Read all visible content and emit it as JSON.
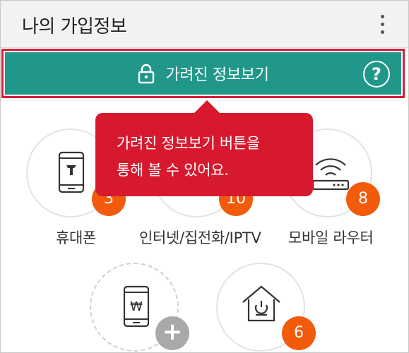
{
  "header": {
    "title": "나의 가입정보",
    "menu_icon": "more-vertical-icon"
  },
  "reveal_bar": {
    "label": "가려진 정보보기",
    "icon": "lock-icon",
    "help": "?",
    "color": "#21978a"
  },
  "tooltip": {
    "line1": "가려진 정보보기 버튼을",
    "line2": "통해 볼 수 있어요.",
    "color": "#d7192e"
  },
  "services": [
    {
      "label": "휴대폰",
      "count": "3",
      "icon": "smartphone-icon"
    },
    {
      "label": "인터넷/집전화/IPTV",
      "count": "10",
      "icon": "home-internet-icon"
    },
    {
      "label": "모바일 라우터",
      "count": "8",
      "icon": "wifi-router-icon"
    },
    {
      "label": "",
      "count": "+",
      "icon": "prepaid-phone-icon"
    },
    {
      "label": "",
      "count": "6",
      "icon": "home-power-icon"
    }
  ],
  "colors": {
    "badge": "#f25a0c",
    "badge_add": "#a9a9a9",
    "highlight_border": "#d6203a"
  }
}
